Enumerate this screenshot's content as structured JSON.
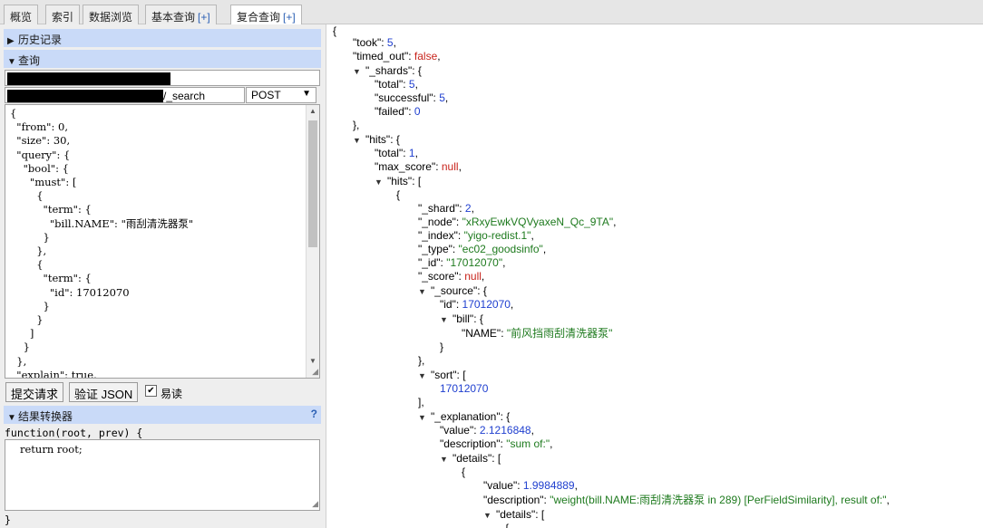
{
  "tabs": [
    {
      "label": "概览",
      "plus": ""
    },
    {
      "label": "索引",
      "plus": ""
    },
    {
      "label": "数据浏览",
      "plus": ""
    },
    {
      "label": "基本查询",
      "plus": "[+]"
    },
    {
      "label": "复合查询",
      "plus": "[+]"
    }
  ],
  "history": {
    "label": "历史记录"
  },
  "query": {
    "label": "查询",
    "path_suffix": "/_search",
    "method": "POST",
    "body_lines": [
      "{",
      "  \"from\": 0,",
      "  \"size\": 30,",
      "  \"query\": {",
      "    \"bool\": {",
      "      \"must\": [",
      "        {",
      "          \"term\": {",
      "            \"bill.NAME\": \"雨刮清洗器泵\"",
      "          }",
      "        },",
      "        {",
      "          \"term\": {",
      "            \"id\": 17012070",
      "          }",
      "        }",
      "      ]",
      "    }",
      "  },",
      "  \"explain\": true,"
    ],
    "submit_label": "提交请求",
    "validate_label": "验证 JSON",
    "pretty_label": "易读",
    "pretty_checked": "✔"
  },
  "transformer": {
    "label": "结果转换器",
    "help": "?",
    "fn_open": "function(root, prev) {",
    "fn_body": "return root;",
    "fn_close": "}"
  },
  "result": {
    "took": "5",
    "timed_out": "false",
    "shards_total": "5",
    "shards_successful": "5",
    "shards_failed": "0",
    "hits_total": "1",
    "max_score": "null",
    "shard": "2",
    "node": "\"xRxyEwkVQVyaxeN_Qc_9TA\"",
    "index": "\"yigo-redist.1\"",
    "type": "\"ec02_goodsinfo\"",
    "id": "\"17012070\"",
    "score": "null",
    "source_id": "17012070",
    "source_bill_name": "\"前风挡雨刮清洗器泵\"",
    "sort_value": "17012070",
    "expl_value": "2.1216848",
    "expl_description": "\"sum of:\"",
    "detail_value": "1.9984889",
    "detail_description": "\"weight(bill.NAME:雨刮清洗器泵 in 289) [PerFieldSimilarity], result of:\""
  }
}
